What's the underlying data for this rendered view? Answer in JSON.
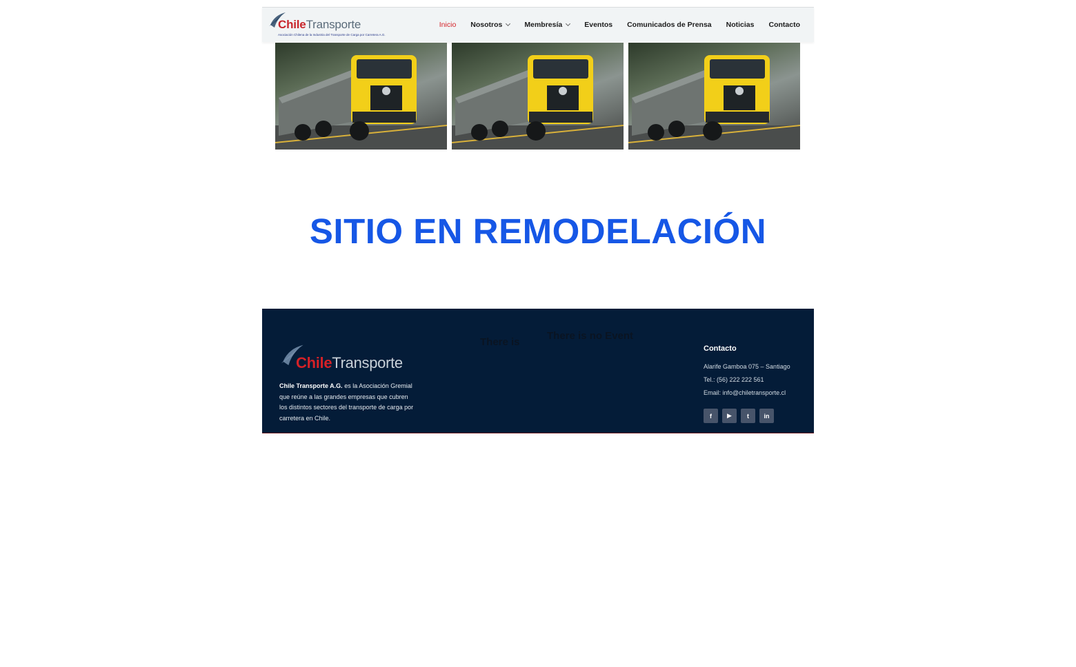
{
  "header": {
    "logo": {
      "brand_part1": "Chile",
      "brand_part2": "Transporte",
      "tagline": "Asociación Chilena de la Industria del Transporte de Carga por Carretera A.G."
    },
    "nav": [
      {
        "label": "Inicio",
        "active": true,
        "dropdown": false
      },
      {
        "label": "Nosotros",
        "active": false,
        "dropdown": true
      },
      {
        "label": "Membresía",
        "active": false,
        "dropdown": true
      },
      {
        "label": "Eventos",
        "active": false,
        "dropdown": false
      },
      {
        "label": "Comunicados de Prensa",
        "active": false,
        "dropdown": false
      },
      {
        "label": "Noticias",
        "active": false,
        "dropdown": false
      },
      {
        "label": "Contacto",
        "active": false,
        "dropdown": false
      }
    ]
  },
  "gallery": {
    "images": [
      "yellow-truck-photo",
      "yellow-truck-photo",
      "yellow-truck-photo"
    ]
  },
  "main": {
    "heading": "SITIO EN REMODELACIÓN"
  },
  "footer": {
    "logo": {
      "brand_part1": "Chile",
      "brand_part2": "Transporte"
    },
    "description_bold": "Chile Transporte A.G.",
    "description_rest": " es la Asociación Gremial que reúne a las grandes empresas que cubren los distintos sectores del transporte de carga por carretera en Chile.",
    "events_text_1": "There is",
    "events_text_2": "There is no Event",
    "contact": {
      "title": "Contacto",
      "address": "Alarife Gamboa 075 – Santiago",
      "phone": "Tel.: (56) 222 222 561",
      "email": "Email: info@chiletransporte.cl"
    },
    "socials": [
      {
        "name": "facebook-icon",
        "glyph": "f"
      },
      {
        "name": "youtube-icon",
        "glyph": "▶"
      },
      {
        "name": "twitter-icon",
        "glyph": "t"
      },
      {
        "name": "linkedin-icon",
        "glyph": "in"
      }
    ]
  },
  "colors": {
    "accent_red": "#d42127",
    "heading_blue": "#1657e6",
    "footer_bg": "#041c38",
    "header_bg": "#f1f4f5"
  }
}
